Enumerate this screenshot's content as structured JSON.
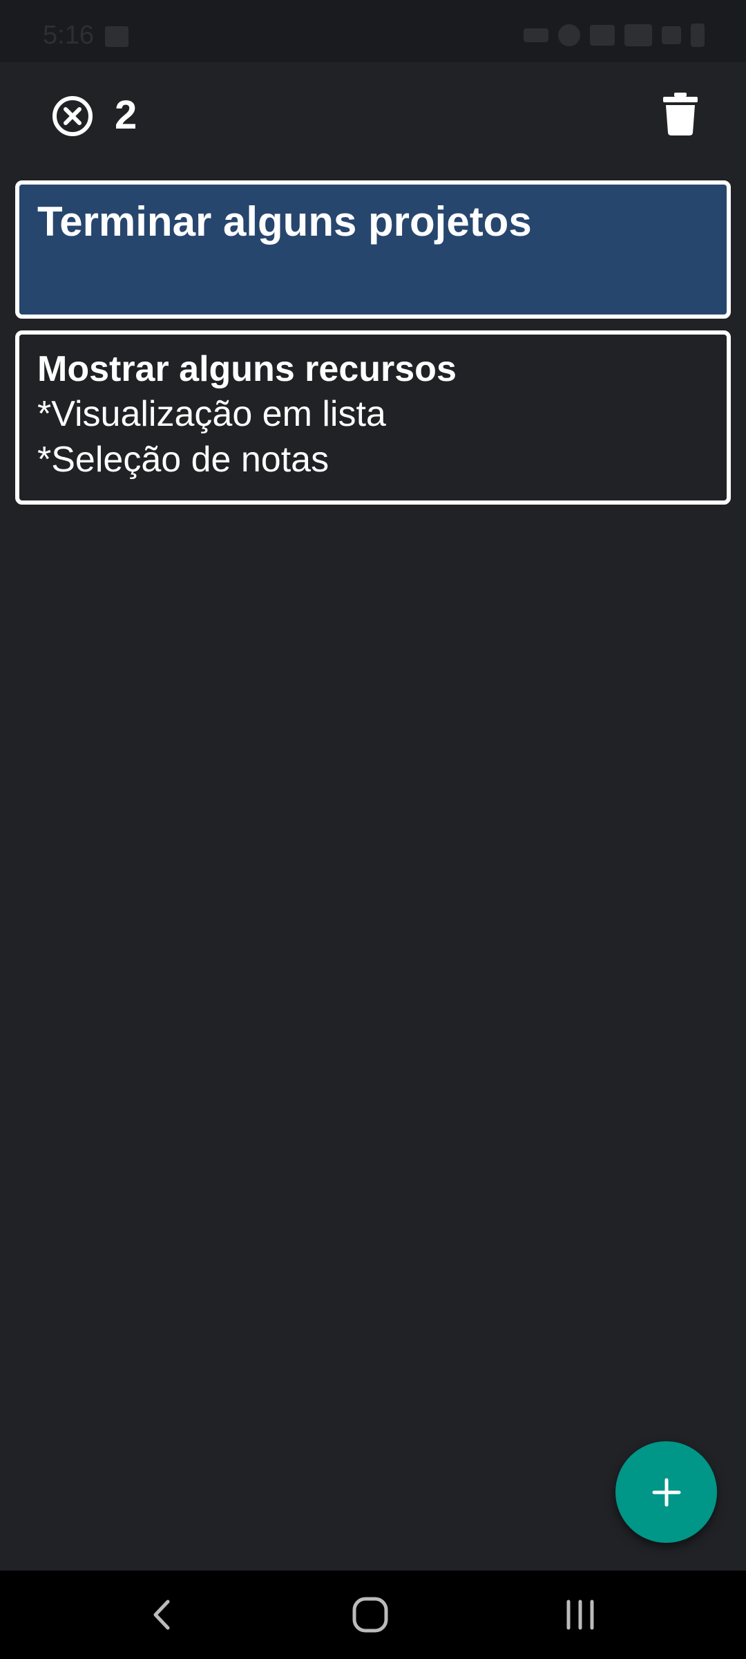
{
  "status_bar": {
    "time": "5:16"
  },
  "toolbar": {
    "selected_count": "2",
    "close_icon": "close-circle-icon",
    "delete_icon": "trash-icon"
  },
  "notes": [
    {
      "title": "Terminar alguns projetos",
      "lines": [],
      "selected": true
    },
    {
      "title": "Mostrar alguns recursos",
      "lines": [
        "*Visualização em lista",
        "*Seleção de notas"
      ],
      "selected": false
    }
  ],
  "fab": {
    "icon": "plus-icon"
  },
  "navigation": {
    "back_icon": "back-icon",
    "home_icon": "home-icon",
    "recents_icon": "recents-icon"
  },
  "colors": {
    "background": "#212226",
    "selected_note": "#27466e",
    "accent": "#009688"
  }
}
